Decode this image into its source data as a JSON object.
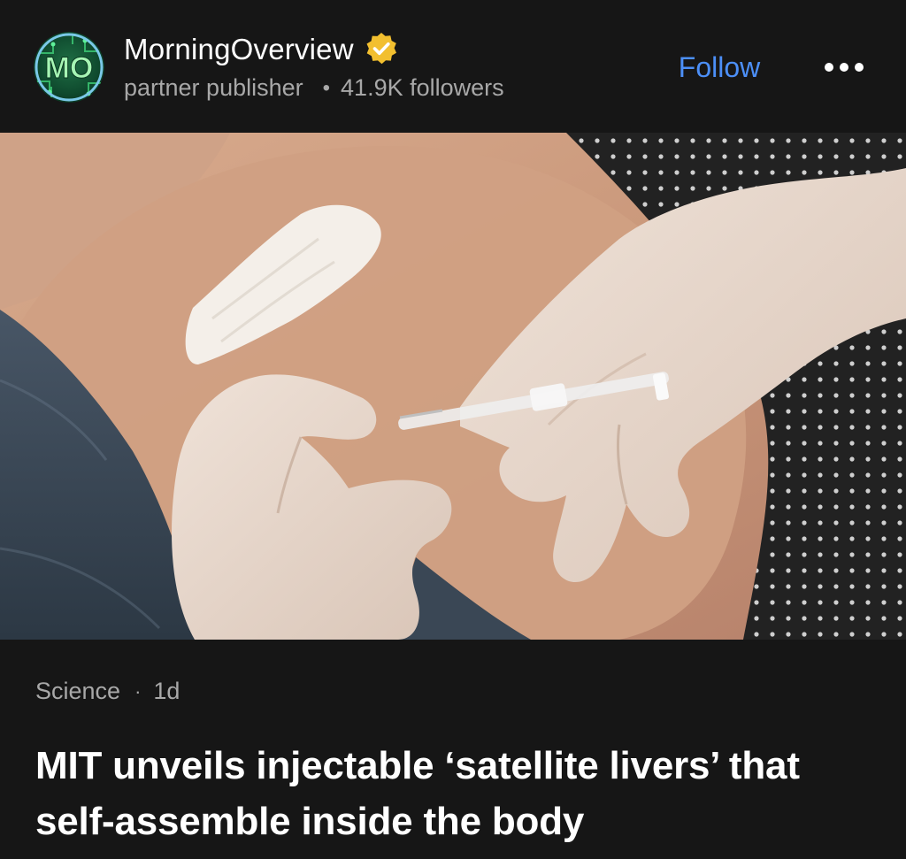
{
  "publisher": {
    "name": "MorningOverview",
    "avatar_text": "MO",
    "type_label": "partner publisher",
    "separator": "•",
    "followers": "41.9K followers",
    "verified_icon": "verified-badge-icon"
  },
  "actions": {
    "follow_label": "Follow",
    "more_icon": "more-horizontal-icon"
  },
  "article": {
    "category": "Science",
    "separator": "·",
    "age": "1d",
    "headline": "MIT unveils injectable ‘satellite livers’ that self-assemble inside the body",
    "image_icon": "article-hero-image"
  },
  "colors": {
    "background": "#161616",
    "accent_link": "#4c8ff7",
    "muted_text": "#a8a8a8",
    "verified_badge": "#f2bf2f",
    "avatar_green": "#39c26b"
  }
}
